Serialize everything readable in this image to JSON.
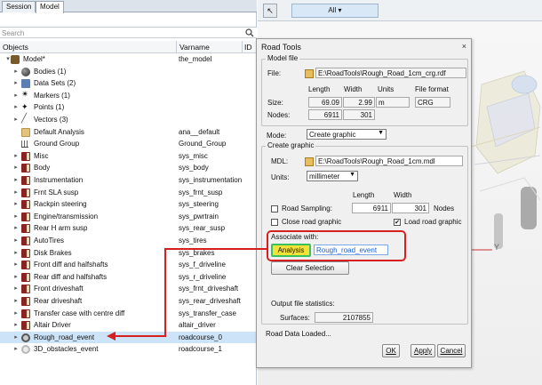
{
  "left_panel": {
    "tabs": [
      "Session",
      "Model"
    ],
    "controls": "◂ ▸ ×",
    "search_placeholder": "Search",
    "columns": {
      "objects": "Objects",
      "varname": "Varname",
      "id": "ID"
    },
    "rows": [
      {
        "label": "Model*",
        "varname": "the_model",
        "icon": "model-root-icon",
        "expand": "▾",
        "indent": 0
      },
      {
        "label": "Bodies (1)",
        "varname": "",
        "icon": "bodies-icon",
        "expand": "▸",
        "indent": 1
      },
      {
        "label": "Data Sets (2)",
        "varname": "",
        "icon": "datasets-icon",
        "expand": "▸",
        "indent": 1
      },
      {
        "label": "Markers (1)",
        "varname": "",
        "icon": "markers-icon",
        "expand": "▸",
        "indent": 1
      },
      {
        "label": "Points (1)",
        "varname": "",
        "icon": "points-icon",
        "expand": "▸",
        "indent": 1
      },
      {
        "label": "Vectors (3)",
        "varname": "",
        "icon": "vectors-icon",
        "expand": "▸",
        "indent": 1
      },
      {
        "label": "Default Analysis",
        "varname": "ana__default",
        "icon": "analysis-folder-icon",
        "expand": "",
        "indent": 1
      },
      {
        "label": "Ground Group",
        "varname": "Ground_Group",
        "icon": "ground-icon",
        "expand": "",
        "indent": 1
      },
      {
        "label": "Misc",
        "varname": "sys_misc",
        "icon": "system-icon",
        "expand": "▸",
        "indent": 1
      },
      {
        "label": "Body",
        "varname": "sys_body",
        "icon": "system-icon",
        "expand": "▸",
        "indent": 1
      },
      {
        "label": "Instrumentation",
        "varname": "sys_instrumentation",
        "icon": "system-icon",
        "expand": "▸",
        "indent": 1
      },
      {
        "label": "Frnt SLA susp",
        "varname": "sys_frnt_susp",
        "icon": "system-icon",
        "expand": "▸",
        "indent": 1
      },
      {
        "label": "Rackpin steering",
        "varname": "sys_steering",
        "icon": "system-icon",
        "expand": "▸",
        "indent": 1
      },
      {
        "label": "Engine/transmission",
        "varname": "sys_pwrtrain",
        "icon": "system-icon",
        "expand": "▸",
        "indent": 1
      },
      {
        "label": "Rear H arm susp",
        "varname": "sys_rear_susp",
        "icon": "system-icon",
        "expand": "▸",
        "indent": 1
      },
      {
        "label": "AutoTires",
        "varname": "sys_tires",
        "icon": "system-icon",
        "expand": "▸",
        "indent": 1
      },
      {
        "label": "Disk Brakes",
        "varname": "sys_brakes",
        "icon": "system-icon",
        "expand": "▸",
        "indent": 1
      },
      {
        "label": "Front diff and halfshafts",
        "varname": "sys_f_driveline",
        "icon": "system-icon",
        "expand": "▸",
        "indent": 1
      },
      {
        "label": "Rear diff and halfshafts",
        "varname": "sys_r_driveline",
        "icon": "system-icon",
        "expand": "▸",
        "indent": 1
      },
      {
        "label": "Front driveshaft",
        "varname": "sys_frnt_driveshaft",
        "icon": "system-icon",
        "expand": "▸",
        "indent": 1
      },
      {
        "label": "Rear driveshaft",
        "varname": "sys_rear_driveshaft",
        "icon": "system-icon",
        "expand": "▸",
        "indent": 1
      },
      {
        "label": "Transfer case with centre diff",
        "varname": "sys_transfer_case",
        "icon": "system-icon",
        "expand": "▸",
        "indent": 1
      },
      {
        "label": "Altair Driver",
        "varname": "altair_driver",
        "icon": "system-icon",
        "expand": "▸",
        "indent": 1
      },
      {
        "label": "Rough_road_event",
        "varname": "roadcourse_0",
        "icon": "road-icon",
        "expand": "▸",
        "indent": 1,
        "selected": true
      },
      {
        "label": "3D_obstacles_event",
        "varname": "roadcourse_1",
        "icon": "road-icon",
        "expand": "▸",
        "indent": 1
      }
    ]
  },
  "toolbar": {
    "pick_glyph": "↖",
    "filter": "All",
    "filter_arrow": "▾"
  },
  "viewport": {
    "axis_label": "Y"
  },
  "dialog": {
    "title": "Road Tools",
    "close": "×",
    "model_file": {
      "group_title": "Model file",
      "file_label": "File:",
      "file_value": "E:\\RoadTools\\Rough_Road_1cm_crg.rdf",
      "headers": {
        "length": "Length",
        "width": "Width",
        "units": "Units",
        "format": "File format"
      },
      "size_label": "Size:",
      "length": "69.09",
      "width": "2.99",
      "units": "m",
      "format": "CRG",
      "nodes_label": "Nodes:",
      "nodes_length": "6911",
      "nodes_width": "301"
    },
    "mode_label": "Mode:",
    "mode_value": "Create graphic",
    "create_graphic": {
      "group_title": "Create graphic",
      "mdl_label": "MDL:",
      "mdl_value": "E:\\RoadTools\\Rough_Road_1cm.mdl",
      "units_label": "Units:",
      "units_value": "millimeter",
      "length_head": "Length",
      "width_head": "Width",
      "road_sampling": "Road Sampling:",
      "sampling_length": "6911",
      "sampling_width": "301",
      "nodes_label": "Nodes",
      "close_road": "Close road graphic",
      "close_road_checked": false,
      "load_road": "Load road graphic",
      "load_road_checked": true,
      "associate_label": "Associate with:",
      "analysis_button": "Analysis",
      "associate_value": "Rough_road_event",
      "clear_button": "Clear Selection",
      "output_label": "Output file statistics:",
      "surfaces_label": "Surfaces:",
      "surfaces_value": "2107855"
    },
    "status": "Road Data Loaded...",
    "ok": "OK",
    "apply": "Apply",
    "cancel": "Cancel"
  },
  "colors": {
    "annotation_red": "#d62020",
    "analysis_button_fill": "#f3e23a",
    "analysis_button_border": "#3cc25b",
    "selection_highlight": "#cde3f7"
  }
}
